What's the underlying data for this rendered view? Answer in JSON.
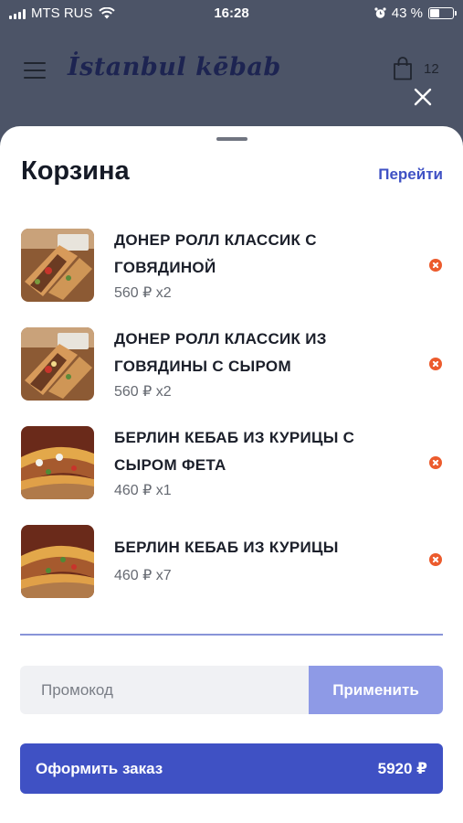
{
  "status_bar": {
    "carrier": "MTS RUS",
    "time": "16:28",
    "battery_text": "43 %",
    "battery_level": 0.43
  },
  "app_header": {
    "logo_text": "İstanbul kēbab",
    "cart_count": "12"
  },
  "cart": {
    "title": "Корзина",
    "goto_label": "Перейти",
    "items": [
      {
        "name_line1": "ДОНЕР РОЛЛ КЛАССИК С",
        "name_line2": "ГОВЯДИНОЙ",
        "price": "560 ₽ x2"
      },
      {
        "name_line1": "ДОНЕР РОЛЛ КЛАССИК ИЗ",
        "name_line2": "ГОВЯДИНЫ С СЫРОМ",
        "price": "560 ₽ x2"
      },
      {
        "name_line1": "БЕРЛИН КЕБАБ ИЗ КУРИЦЫ С",
        "name_line2": "СЫРОМ ФЕТА",
        "price": "460 ₽ x1"
      },
      {
        "name_line1": "БЕРЛИН КЕБАБ ИЗ КУРИЦЫ",
        "name_line2": "",
        "price": "460 ₽ x7"
      }
    ],
    "promo_placeholder": "Промокод",
    "apply_label": "Применить",
    "checkout_label": "Оформить заказ",
    "checkout_total": "5920 ₽"
  },
  "colors": {
    "accent": "#3f51c4",
    "accent_light": "#8e9ae6",
    "remove": "#ec5b2d",
    "overlay": "#4c5467"
  }
}
